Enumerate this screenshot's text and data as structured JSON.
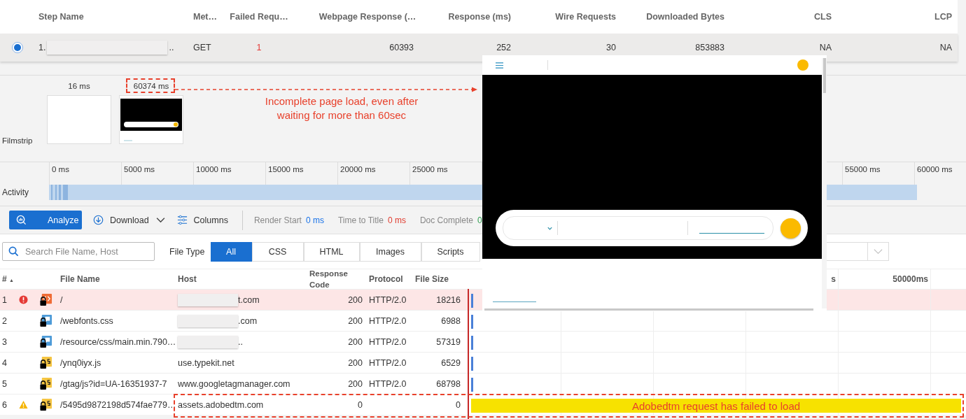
{
  "steps": {
    "columns": [
      "Step Name",
      "Met…",
      "Failed Requ…",
      "Webpage Response (…",
      "Response (ms)",
      "Wire Requests",
      "Downloaded Bytes",
      "CLS",
      "LCP"
    ],
    "rows": [
      {
        "selected": true,
        "number": "1.",
        "name": "..",
        "method": "GET",
        "failed": "1",
        "webpage_response": "60393",
        "response": "252",
        "wire_requests": "30",
        "downloaded_bytes": "853883",
        "cls": "NA",
        "lcp": "NA"
      }
    ]
  },
  "filmstrip": {
    "label": "Filmstrip",
    "frames": [
      {
        "time": "16 ms",
        "kind": "blank"
      },
      {
        "time": "60374 ms",
        "kind": "page"
      }
    ]
  },
  "activity": {
    "label": "Activity",
    "ticks": [
      "0 ms",
      "5000 ms",
      "10000 ms",
      "15000 ms",
      "20000 ms",
      "25000 ms",
      "55000 ms",
      "60000 ms"
    ]
  },
  "toolbar": {
    "analyze": "Analyze",
    "download": "Download",
    "columns": "Columns",
    "metrics": [
      {
        "label": "Render Start",
        "value": "0 ms",
        "color": "#1a73e8"
      },
      {
        "label": "Time to Title",
        "value": "0 ms",
        "color": "#e03b2e"
      },
      {
        "label": "Doc Complete",
        "value": "0",
        "color": "#2e9e4f"
      }
    ]
  },
  "filter": {
    "placeholder": "Search File Name, Host",
    "file_type_label": "File Type",
    "types": [
      {
        "label": "All",
        "selected": true
      },
      {
        "label": "CSS",
        "selected": false
      },
      {
        "label": "HTML",
        "selected": false
      },
      {
        "label": "Images",
        "selected": false
      },
      {
        "label": "Scripts",
        "selected": false
      }
    ]
  },
  "files": {
    "sort_indicator": "▲",
    "columns": [
      "#",
      "File Name",
      "Host",
      "Response Code",
      "Protocol",
      "File Size"
    ],
    "waterfall_ticks": [
      "s",
      "50000ms"
    ],
    "rows": [
      {
        "num": "1",
        "error": true,
        "warning": false,
        "kind": "html",
        "selected": true,
        "file": "/",
        "host": "t.com",
        "redacted": true,
        "code": "200",
        "protocol": "HTTP/2.0",
        "size": "18216",
        "color": "#4a80d8"
      },
      {
        "num": "2",
        "error": false,
        "warning": false,
        "kind": "css",
        "selected": false,
        "file": "/webfonts.css",
        "host": ".com",
        "redacted": true,
        "code": "200",
        "protocol": "HTTP/2.0",
        "size": "6988",
        "color": "#4a80d8"
      },
      {
        "num": "3",
        "error": false,
        "warning": false,
        "kind": "css",
        "selected": false,
        "file": "/resource/css/main.min.790…",
        "host": "..",
        "redacted": true,
        "code": "200",
        "protocol": "HTTP/2.0",
        "size": "57319",
        "color": "#4a80d8"
      },
      {
        "num": "4",
        "error": false,
        "warning": false,
        "kind": "js",
        "selected": false,
        "file": "/ynq0iyx.js",
        "host": "use.typekit.net",
        "redacted": false,
        "code": "200",
        "protocol": "HTTP/2.0",
        "size": "6529",
        "color": "#4a80d8"
      },
      {
        "num": "5",
        "error": false,
        "warning": false,
        "kind": "js",
        "selected": false,
        "file": "/gtag/js?id=UA-16351937-7",
        "host": "www.googletagmanager.com",
        "redacted": false,
        "code": "200",
        "protocol": "HTTP/2.0",
        "size": "68798",
        "color": "#4a80d8"
      },
      {
        "num": "6",
        "error": false,
        "warning": true,
        "kind": "js",
        "selected": false,
        "file": "/5495d9872198d574fae779…",
        "host": "assets.adobedtm.com",
        "redacted": false,
        "code": "0",
        "size": "0",
        "color": "#f7e200"
      }
    ]
  },
  "annotations": [
    {
      "kind": "filmstrip",
      "text": "Incomplete page load, even after waiting for more than 60sec"
    },
    {
      "kind": "row",
      "text": "Adobedtm request has failed to load"
    }
  ]
}
